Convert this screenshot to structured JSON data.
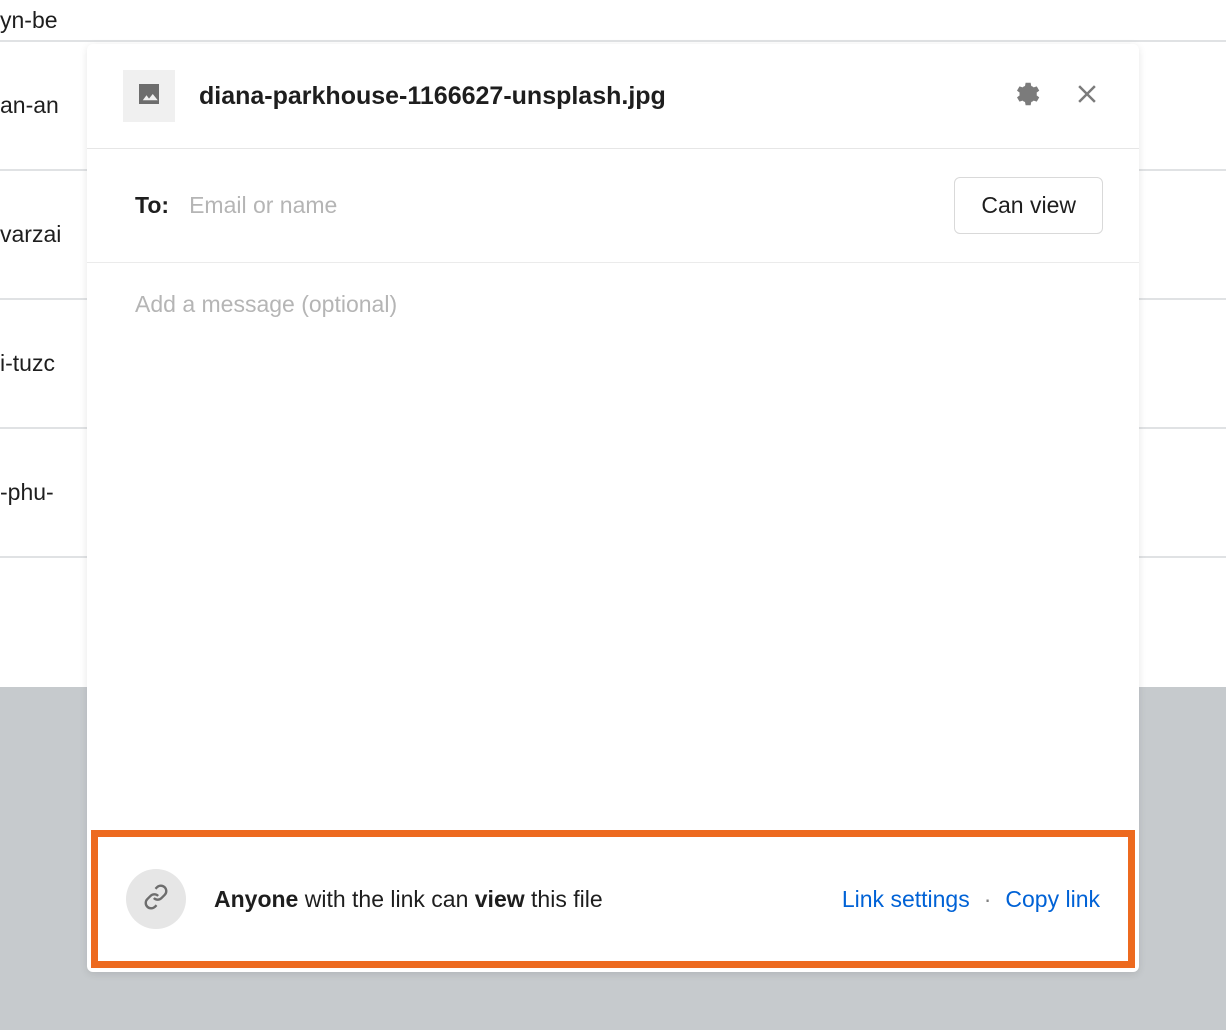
{
  "background_rows": [
    "yn-be",
    "an-an",
    "varzai",
    "i-tuzc",
    "-phu-"
  ],
  "modal": {
    "filename": "diana-parkhouse-1166627-unsplash.jpg",
    "icons": {
      "thumbnail": "image-icon",
      "gear": "gear-icon",
      "close": "close-icon",
      "link": "chain-link-icon"
    },
    "recipient": {
      "to_label": "To:",
      "email_placeholder": "Email or name",
      "permission_label": "Can view"
    },
    "message_placeholder": "Add a message (optional)",
    "footer": {
      "access_text": {
        "part1_bold": "Anyone",
        "part2": " with the link can ",
        "part3_bold": "view",
        "part4": " this file"
      },
      "link_settings": "Link settings",
      "separator": "·",
      "copy_link": "Copy link"
    }
  }
}
